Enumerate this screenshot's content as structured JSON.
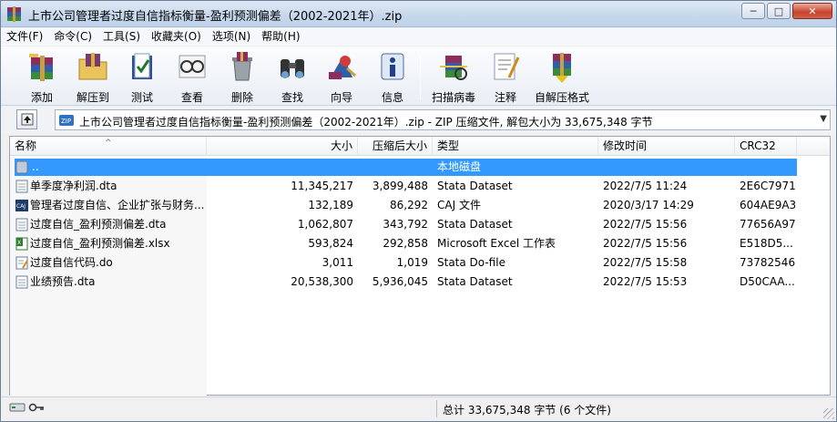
{
  "window": {
    "title": "上市公司管理者过度自信指标衡量-盈利预测偏差（2002-2021年）.zip",
    "controls": {
      "minimize": "─",
      "maximize": "□",
      "close": "✕"
    }
  },
  "menu": [
    {
      "label": "文件(F)"
    },
    {
      "label": "命令(C)"
    },
    {
      "label": "工具(S)"
    },
    {
      "label": "收藏夹(O)"
    },
    {
      "label": "选项(N)"
    },
    {
      "label": "帮助(H)"
    }
  ],
  "toolbar": [
    {
      "label": "添加",
      "icon": "add-archive-icon"
    },
    {
      "label": "解压到",
      "icon": "extract-to-icon"
    },
    {
      "label": "测试",
      "icon": "test-icon"
    },
    {
      "label": "查看",
      "icon": "view-icon"
    },
    {
      "label": "删除",
      "icon": "delete-icon"
    },
    {
      "label": "查找",
      "icon": "find-icon"
    },
    {
      "label": "向导",
      "icon": "wizard-icon"
    },
    {
      "label": "信息",
      "icon": "info-icon"
    },
    {
      "label": "扫描病毒",
      "icon": "virus-scan-icon"
    },
    {
      "label": "注释",
      "icon": "comment-icon"
    },
    {
      "label": "自解压格式",
      "icon": "sfx-icon"
    }
  ],
  "address": {
    "text": "上市公司管理者过度自信指标衡量-盈利预测偏差（2002-2021年）.zip - ZIP 压缩文件, 解包大小为 33,675,348 字节"
  },
  "columns": [
    "名称",
    "大小",
    "压缩后大小",
    "类型",
    "修改时间",
    "CRC32"
  ],
  "parent_row": {
    "name": "..",
    "type": "本地磁盘"
  },
  "files": [
    {
      "name": "单季度净利润.dta",
      "size": "11,345,217",
      "packed": "3,899,488",
      "type": "Stata Dataset",
      "modified": "2022/7/5 11:24",
      "crc": "2E6C7971",
      "icon": "stata-file-icon"
    },
    {
      "name": "管理者过度自信、企业扩张与财务...",
      "size": "132,189",
      "packed": "86,292",
      "type": "CAJ 文件",
      "modified": "2020/3/17 14:29",
      "crc": "604AE9A3",
      "icon": "caj-file-icon"
    },
    {
      "name": "过度自信_盈利预测偏差.dta",
      "size": "1,062,807",
      "packed": "343,792",
      "type": "Stata Dataset",
      "modified": "2022/7/5 15:56",
      "crc": "77656A97",
      "icon": "stata-file-icon"
    },
    {
      "name": "过度自信_盈利预测偏差.xlsx",
      "size": "593,824",
      "packed": "292,858",
      "type": "Microsoft Excel 工作表",
      "modified": "2022/7/5 15:56",
      "crc": "E518D5...",
      "icon": "excel-file-icon"
    },
    {
      "name": "过度自信代码.do",
      "size": "3,011",
      "packed": "1,019",
      "type": "Stata Do-file",
      "modified": "2022/7/5 15:58",
      "crc": "73782546",
      "icon": "do-file-icon"
    },
    {
      "name": "业绩预告.dta",
      "size": "20,538,300",
      "packed": "5,936,045",
      "type": "Stata Dataset",
      "modified": "2022/7/5 15:53",
      "crc": "D50CAA...",
      "icon": "stata-file-icon"
    }
  ],
  "status": {
    "summary": "总计 33,675,348 字节 (6 个文件)"
  }
}
